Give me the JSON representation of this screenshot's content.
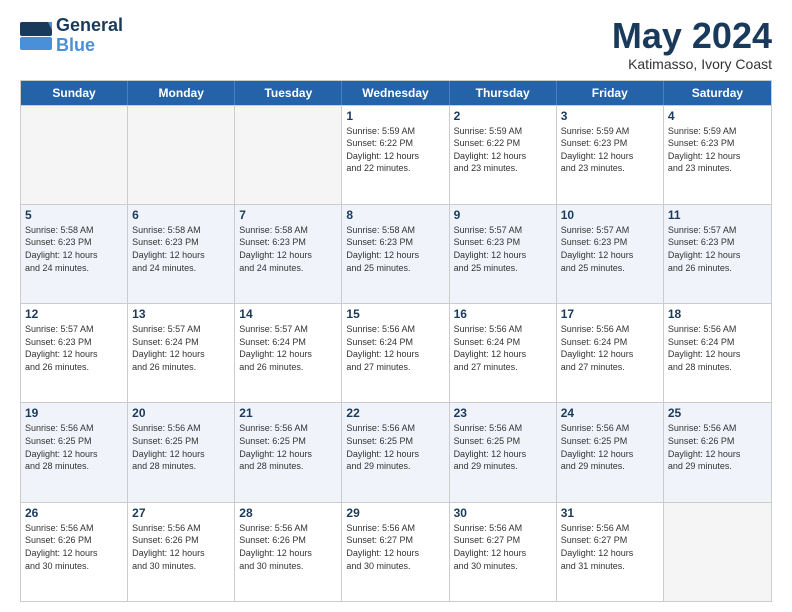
{
  "header": {
    "logo_line1": "General",
    "logo_line2": "Blue",
    "main_title": "May 2024",
    "subtitle": "Katimasso, Ivory Coast"
  },
  "days_of_week": [
    "Sunday",
    "Monday",
    "Tuesday",
    "Wednesday",
    "Thursday",
    "Friday",
    "Saturday"
  ],
  "weeks": [
    [
      {
        "day": "",
        "info": ""
      },
      {
        "day": "",
        "info": ""
      },
      {
        "day": "",
        "info": ""
      },
      {
        "day": "1",
        "info": "Sunrise: 5:59 AM\nSunset: 6:22 PM\nDaylight: 12 hours\nand 22 minutes."
      },
      {
        "day": "2",
        "info": "Sunrise: 5:59 AM\nSunset: 6:22 PM\nDaylight: 12 hours\nand 23 minutes."
      },
      {
        "day": "3",
        "info": "Sunrise: 5:59 AM\nSunset: 6:23 PM\nDaylight: 12 hours\nand 23 minutes."
      },
      {
        "day": "4",
        "info": "Sunrise: 5:59 AM\nSunset: 6:23 PM\nDaylight: 12 hours\nand 23 minutes."
      }
    ],
    [
      {
        "day": "5",
        "info": "Sunrise: 5:58 AM\nSunset: 6:23 PM\nDaylight: 12 hours\nand 24 minutes."
      },
      {
        "day": "6",
        "info": "Sunrise: 5:58 AM\nSunset: 6:23 PM\nDaylight: 12 hours\nand 24 minutes."
      },
      {
        "day": "7",
        "info": "Sunrise: 5:58 AM\nSunset: 6:23 PM\nDaylight: 12 hours\nand 24 minutes."
      },
      {
        "day": "8",
        "info": "Sunrise: 5:58 AM\nSunset: 6:23 PM\nDaylight: 12 hours\nand 25 minutes."
      },
      {
        "day": "9",
        "info": "Sunrise: 5:57 AM\nSunset: 6:23 PM\nDaylight: 12 hours\nand 25 minutes."
      },
      {
        "day": "10",
        "info": "Sunrise: 5:57 AM\nSunset: 6:23 PM\nDaylight: 12 hours\nand 25 minutes."
      },
      {
        "day": "11",
        "info": "Sunrise: 5:57 AM\nSunset: 6:23 PM\nDaylight: 12 hours\nand 26 minutes."
      }
    ],
    [
      {
        "day": "12",
        "info": "Sunrise: 5:57 AM\nSunset: 6:23 PM\nDaylight: 12 hours\nand 26 minutes."
      },
      {
        "day": "13",
        "info": "Sunrise: 5:57 AM\nSunset: 6:24 PM\nDaylight: 12 hours\nand 26 minutes."
      },
      {
        "day": "14",
        "info": "Sunrise: 5:57 AM\nSunset: 6:24 PM\nDaylight: 12 hours\nand 26 minutes."
      },
      {
        "day": "15",
        "info": "Sunrise: 5:56 AM\nSunset: 6:24 PM\nDaylight: 12 hours\nand 27 minutes."
      },
      {
        "day": "16",
        "info": "Sunrise: 5:56 AM\nSunset: 6:24 PM\nDaylight: 12 hours\nand 27 minutes."
      },
      {
        "day": "17",
        "info": "Sunrise: 5:56 AM\nSunset: 6:24 PM\nDaylight: 12 hours\nand 27 minutes."
      },
      {
        "day": "18",
        "info": "Sunrise: 5:56 AM\nSunset: 6:24 PM\nDaylight: 12 hours\nand 28 minutes."
      }
    ],
    [
      {
        "day": "19",
        "info": "Sunrise: 5:56 AM\nSunset: 6:25 PM\nDaylight: 12 hours\nand 28 minutes."
      },
      {
        "day": "20",
        "info": "Sunrise: 5:56 AM\nSunset: 6:25 PM\nDaylight: 12 hours\nand 28 minutes."
      },
      {
        "day": "21",
        "info": "Sunrise: 5:56 AM\nSunset: 6:25 PM\nDaylight: 12 hours\nand 28 minutes."
      },
      {
        "day": "22",
        "info": "Sunrise: 5:56 AM\nSunset: 6:25 PM\nDaylight: 12 hours\nand 29 minutes."
      },
      {
        "day": "23",
        "info": "Sunrise: 5:56 AM\nSunset: 6:25 PM\nDaylight: 12 hours\nand 29 minutes."
      },
      {
        "day": "24",
        "info": "Sunrise: 5:56 AM\nSunset: 6:25 PM\nDaylight: 12 hours\nand 29 minutes."
      },
      {
        "day": "25",
        "info": "Sunrise: 5:56 AM\nSunset: 6:26 PM\nDaylight: 12 hours\nand 29 minutes."
      }
    ],
    [
      {
        "day": "26",
        "info": "Sunrise: 5:56 AM\nSunset: 6:26 PM\nDaylight: 12 hours\nand 30 minutes."
      },
      {
        "day": "27",
        "info": "Sunrise: 5:56 AM\nSunset: 6:26 PM\nDaylight: 12 hours\nand 30 minutes."
      },
      {
        "day": "28",
        "info": "Sunrise: 5:56 AM\nSunset: 6:26 PM\nDaylight: 12 hours\nand 30 minutes."
      },
      {
        "day": "29",
        "info": "Sunrise: 5:56 AM\nSunset: 6:27 PM\nDaylight: 12 hours\nand 30 minutes."
      },
      {
        "day": "30",
        "info": "Sunrise: 5:56 AM\nSunset: 6:27 PM\nDaylight: 12 hours\nand 30 minutes."
      },
      {
        "day": "31",
        "info": "Sunrise: 5:56 AM\nSunset: 6:27 PM\nDaylight: 12 hours\nand 31 minutes."
      },
      {
        "day": "",
        "info": ""
      }
    ]
  ]
}
